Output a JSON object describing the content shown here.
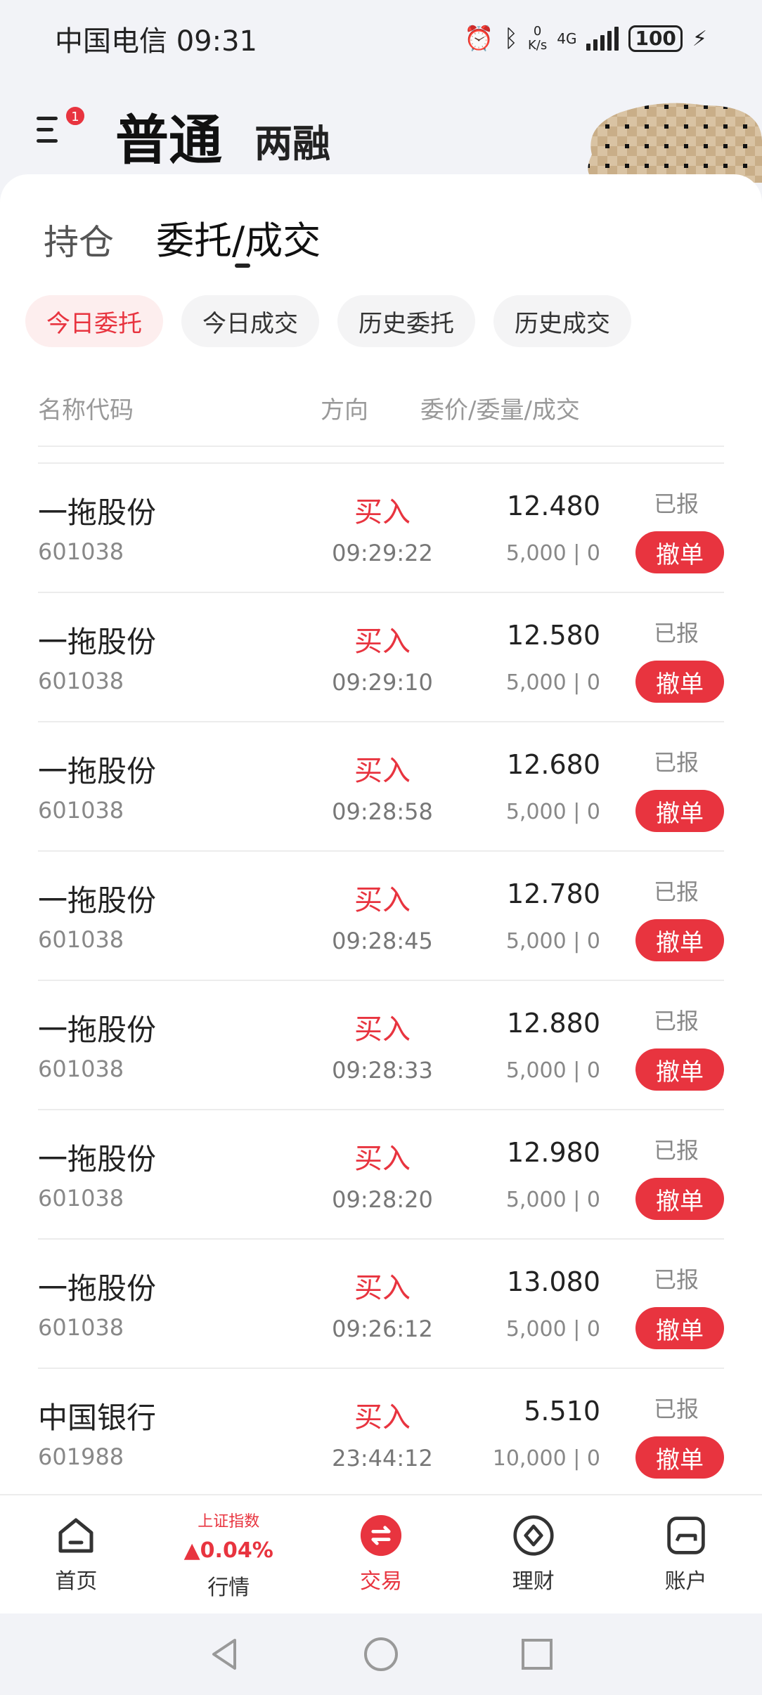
{
  "status_bar": {
    "carrier": "中国电信",
    "time": "09:31",
    "net_speed_value": "0",
    "net_speed_unit": "K/s",
    "network": "4G",
    "battery": "100"
  },
  "header": {
    "menu_badge": "1",
    "tab_normal": "普通",
    "tab_margin": "两融"
  },
  "subtabs": {
    "hold": "持仓",
    "order": "委托/成交"
  },
  "filters": [
    "今日委托",
    "今日成交",
    "历史委托",
    "历史成交"
  ],
  "columns": {
    "name": "名称代码",
    "direction": "方向",
    "price": "委价/委量/成交"
  },
  "orders": [
    {
      "name": "一拖股份",
      "code": "601038",
      "dir": "买入",
      "time": "09:29:22",
      "price": "12.480",
      "qty": "5,000 | 0",
      "status": "已报",
      "cancel": "撤单"
    },
    {
      "name": "一拖股份",
      "code": "601038",
      "dir": "买入",
      "time": "09:29:10",
      "price": "12.580",
      "qty": "5,000 | 0",
      "status": "已报",
      "cancel": "撤单"
    },
    {
      "name": "一拖股份",
      "code": "601038",
      "dir": "买入",
      "time": "09:28:58",
      "price": "12.680",
      "qty": "5,000 | 0",
      "status": "已报",
      "cancel": "撤单"
    },
    {
      "name": "一拖股份",
      "code": "601038",
      "dir": "买入",
      "time": "09:28:45",
      "price": "12.780",
      "qty": "5,000 | 0",
      "status": "已报",
      "cancel": "撤单"
    },
    {
      "name": "一拖股份",
      "code": "601038",
      "dir": "买入",
      "time": "09:28:33",
      "price": "12.880",
      "qty": "5,000 | 0",
      "status": "已报",
      "cancel": "撤单"
    },
    {
      "name": "一拖股份",
      "code": "601038",
      "dir": "买入",
      "time": "09:28:20",
      "price": "12.980",
      "qty": "5,000 | 0",
      "status": "已报",
      "cancel": "撤单"
    },
    {
      "name": "一拖股份",
      "code": "601038",
      "dir": "买入",
      "time": "09:26:12",
      "price": "13.080",
      "qty": "5,000 | 0",
      "status": "已报",
      "cancel": "撤单"
    },
    {
      "name": "中国银行",
      "code": "601988",
      "dir": "买入",
      "time": "23:44:12",
      "price": "5.510",
      "qty": "10,000 | 0",
      "status": "已报",
      "cancel": "撤单"
    }
  ],
  "bottom_nav": {
    "home": "首页",
    "index_name": "上证指数",
    "index_value": "▲0.04%",
    "market": "行情",
    "trade": "交易",
    "finance": "理财",
    "account": "账户"
  },
  "colors": {
    "accent": "#e8343f",
    "background": "#f2f3f7"
  }
}
